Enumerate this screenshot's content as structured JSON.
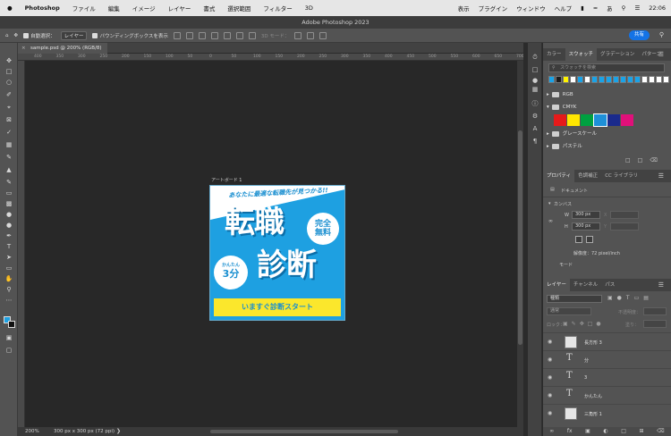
{
  "macbar": {
    "apple": "",
    "app": "Photoshop",
    "menus": [
      "ファイル",
      "編集",
      "イメージ",
      "レイヤー",
      "書式",
      "選択範囲",
      "フィルター",
      "3D"
    ],
    "right_menus": [
      "表示",
      "プラグイン",
      "ウィンドウ",
      "ヘルプ"
    ],
    "clock": "22:06"
  },
  "window": {
    "title": "Adobe Photoshop 2023"
  },
  "options": {
    "auto_select_label": "自動選択：",
    "auto_select_value": "レイヤー",
    "bbox_label": "バウンディングボックスを表示",
    "mode_3d": "3D モード：",
    "share": "共有"
  },
  "document": {
    "tab": "sample.psd @ 200% (RGB/8)",
    "close": "×",
    "artboard_label": "アートボード 1",
    "status_zoom": "200%",
    "status_info": "300 px x 300 px (72 ppi)"
  },
  "ruler": [
    "400",
    "350",
    "300",
    "250",
    "200",
    "150",
    "100",
    "50",
    "0",
    "50",
    "100",
    "150",
    "200",
    "250",
    "300",
    "350",
    "400",
    "450",
    "500",
    "550",
    "600",
    "650",
    "700"
  ],
  "artwork": {
    "headline": "あなたに最適な転職先が見つかる!!",
    "big1": "転職",
    "big2": "診断",
    "badge_free_1": "完全",
    "badge_free_2": "無料",
    "badge_easy_small": "かんたん",
    "badge_easy_num": "3分",
    "cta": "いますぐ診断スタート"
  },
  "swatches": {
    "tabs": [
      "カラー",
      "スウォッチ",
      "グラデーション",
      "パターン"
    ],
    "search_placeholder": "スウォッチを検索",
    "row_colors": [
      "#19a3e8",
      "#1d1d1d",
      "#fff200",
      "#ffffff",
      "#19a3e8",
      "#ffffff",
      "#19a3e8",
      "#19a3e8",
      "#19a3e8",
      "#19a3e8",
      "#19a3e8",
      "#19a3e8",
      "#19a3e8",
      "#ffffff",
      "#ffffff",
      "#ffffff",
      "#ffffff"
    ],
    "groups": [
      "RGB",
      "CMYK",
      "グレースケール",
      "パステル"
    ],
    "cmyk_colors": [
      "#e61a1a",
      "#ffe600",
      "#00a040",
      "#1e90d8",
      "#1a2a8c",
      "#e0107a"
    ]
  },
  "properties": {
    "tabs": [
      "プロパティ",
      "色調補正",
      "CC ライブラリ"
    ],
    "doc_label": "ドキュメント",
    "canvas_label": "カンバス",
    "w_label": "W",
    "w_value": "300 px",
    "h_label": "H",
    "h_value": "300 px",
    "x_label": "X",
    "y_label": "Y",
    "resolution": "解像度：72 pixel/inch",
    "mode": "モード"
  },
  "layers": {
    "tabs": [
      "レイヤー",
      "チャンネル",
      "パス"
    ],
    "kind": "種類",
    "blend": "通常",
    "opacity_label": "不透明度：",
    "lock_label": "ロック：",
    "fill_label": "塗り：",
    "items": [
      {
        "name": "長方形 3",
        "type": "shape"
      },
      {
        "name": "分",
        "type": "text"
      },
      {
        "name": "3",
        "type": "text"
      },
      {
        "name": "かんたん",
        "type": "text"
      },
      {
        "name": "三角形 1",
        "type": "shape"
      }
    ],
    "type_glyph": "T"
  }
}
